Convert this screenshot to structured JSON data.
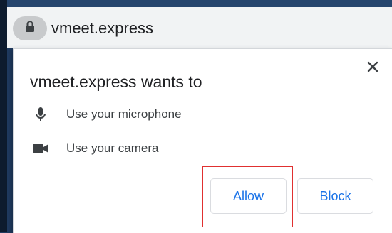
{
  "browser": {
    "url": "vmeet.express",
    "lock_icon": "lock-icon"
  },
  "permission_dialog": {
    "title": "vmeet.express wants to",
    "close_icon": "close-icon",
    "permissions": [
      {
        "icon": "microphone-icon",
        "label": "Use your microphone"
      },
      {
        "icon": "camera-icon",
        "label": "Use your camera"
      }
    ],
    "buttons": {
      "allow_label": "Allow",
      "block_label": "Block"
    }
  },
  "colors": {
    "accent": "#1a73e8",
    "highlight": "#e03030",
    "address_bar": "#f1f3f4",
    "background": "#1f3a5f"
  }
}
